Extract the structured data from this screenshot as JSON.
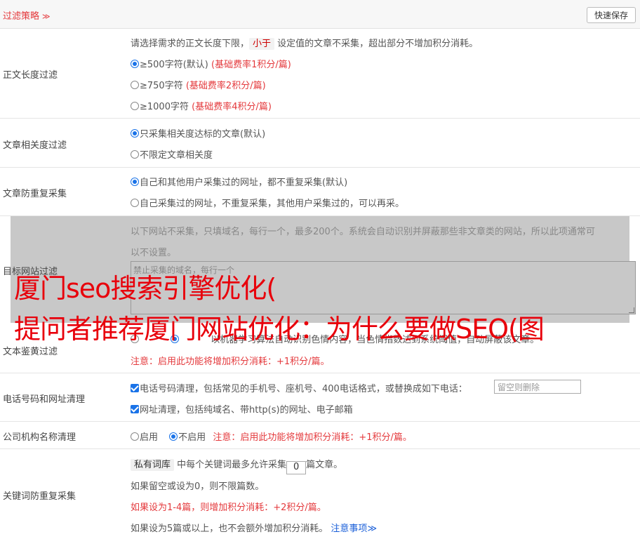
{
  "header": {
    "title": "过滤策略",
    "chevron": "≫",
    "save_label": "快速保存"
  },
  "length_filter": {
    "label": "正文长度过滤",
    "hint_pre": "请选择需求的正文长度下限，",
    "hint_tag": "小于",
    "hint_post": "设定值的文章不采集，超出部分不增加积分消耗。",
    "options": [
      {
        "text": "≥500字符(默认)",
        "note": "(基础费率1积分/篇)",
        "checked": true
      },
      {
        "text": "≥750字符",
        "note": "(基础费率2积分/篇)",
        "checked": false
      },
      {
        "text": "≥1000字符",
        "note": "(基础费率4积分/篇)",
        "checked": false
      }
    ]
  },
  "relevance_filter": {
    "label": "文章相关度过滤",
    "options": [
      {
        "text": "只采集相关度达标的文章(默认)",
        "checked": true
      },
      {
        "text": "不限定文章相关度",
        "checked": false
      }
    ]
  },
  "dedupe": {
    "label": "文章防重复采集",
    "options": [
      {
        "text": "自己和其他用户采集过的网址，都不重复采集(默认)",
        "checked": true
      },
      {
        "text": "自己采集过的网址，不重复采集，其他用户采集过的，可以再采。",
        "checked": false
      }
    ]
  },
  "site_filter": {
    "label": "目标网站过滤",
    "hint_line1": "以下网站不采集，只填域名，每行一个，最多200个。系统会自动识别并屏蔽那些非文章类的网站，所以此项通常可",
    "hint_line2": "以不设置。",
    "placeholder": "禁止采集的域名，每行一个"
  },
  "porn_filter": {
    "label": "文本鉴黄过滤",
    "desc": "以机器学习算法自动识别色情内容，当色情指数达到系统阈值，自动屏蔽该文章。",
    "warning": "注意：启用此功能将增加积分消耗：+1积分/篇。"
  },
  "contact_clean": {
    "label": "电话号码和网址清理",
    "phone_text": "电话号码清理，包括常见的手机号、座机号、400电话格式，或替换成如下电话：",
    "phone_placeholder": "留空则删除",
    "url_text": "网址清理，包括纯域名、带http(s)的网址、电子邮箱"
  },
  "org_clean": {
    "label": "公司机构名称清理",
    "enable": "启用",
    "disable": "不启用",
    "warning": "注意：启用此功能将增加积分消耗：+1积分/篇。"
  },
  "keyword_dedupe": {
    "label": "关键词防重复采集",
    "tag": "私有词库",
    "text_pre": "中每个关键词最多允许采集",
    "value": "0",
    "text_post": "篇文章。",
    "line2": "如果留空或设为0，则不限篇数。",
    "line3": "如果设为1-4篇，则增加积分消耗：+2积分/篇。",
    "line4": "如果设为5篇或以上，也不会额外增加积分消耗。",
    "notice_link": "注意事项",
    "notice_chevron": "≫"
  },
  "watermark": {
    "line1": "厦门seo搜索引擎优化(",
    "line2": "提问者推荐厦门网站优化：为什么要做SEO(图"
  },
  "colors": {
    "accent_red": "#e4393c",
    "brand_blue": "#1a73e8",
    "overlay_gray": "#c8c8c8"
  }
}
